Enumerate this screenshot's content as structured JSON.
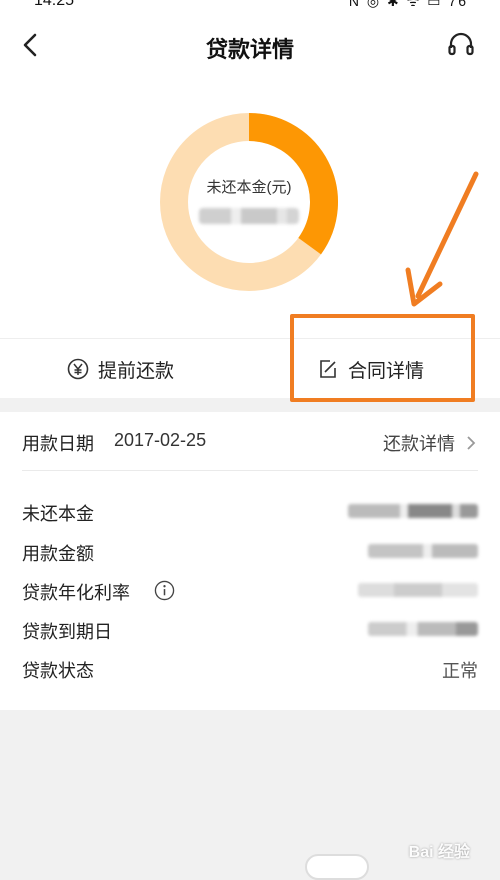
{
  "status_bar": {
    "time": "14:25",
    "icons": "N ◎ ✱ ᯤ ▭ 76"
  },
  "nav": {
    "title": "贷款详情",
    "back_icon": "chevron-left-icon",
    "service_icon": "headset-icon"
  },
  "summary": {
    "label": "未还本金(元)",
    "repaid_fraction": 0.35,
    "colors": {
      "remaining": "#fdddb2",
      "repaid": "#fd9704"
    }
  },
  "actions": {
    "prepay_label": "提前还款",
    "contract_label": "合同详情",
    "highlight_color": "#f07d22"
  },
  "loan": {
    "date_label": "用款日期",
    "date_value": "2017-02-25",
    "repay_detail_label": "还款详情",
    "rows": [
      {
        "label": "未还本金"
      },
      {
        "label": "用款金额"
      },
      {
        "label": "贷款年化利率"
      },
      {
        "label": "贷款到期日"
      },
      {
        "label": "贷款状态",
        "value": "正常"
      }
    ]
  },
  "watermark": "Bai 经验"
}
